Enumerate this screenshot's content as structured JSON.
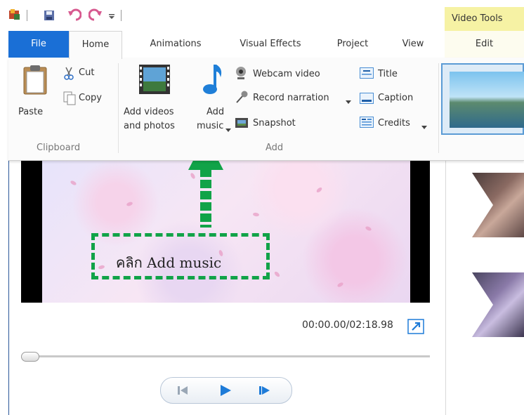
{
  "contextual_tab_group": "Video Tools",
  "tabs": {
    "file": "File",
    "home": "Home",
    "animations": "Animations",
    "visual_effects": "Visual Effects",
    "project": "Project",
    "view": "View",
    "edit": "Edit"
  },
  "ribbon": {
    "clipboard": {
      "paste": "Paste",
      "cut": "Cut",
      "copy": "Copy",
      "group_label": "Clipboard"
    },
    "add": {
      "add_videos_line1": "Add videos",
      "add_videos_line2": "and photos",
      "add_music_line1": "Add",
      "add_music_line2": "music",
      "webcam_video": "Webcam video",
      "record_narration": "Record narration",
      "snapshot": "Snapshot",
      "title": "Title",
      "caption": "Caption",
      "credits": "Credits",
      "group_label": "Add"
    }
  },
  "preview": {
    "time": "00:00.00/02:18.98"
  },
  "annotation": {
    "text": "คลิก Add music",
    "color": "#11a348"
  },
  "colors": {
    "file_tab": "#1a6fd6",
    "contextual": "#f6f2a4",
    "accent_blue": "#1e7bd8"
  }
}
